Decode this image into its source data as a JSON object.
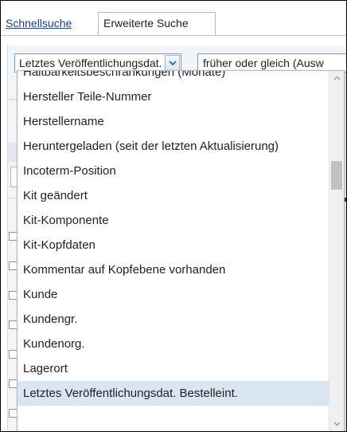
{
  "tabs": {
    "quick_search": "Schnellsuche",
    "extended_search": "Erweiterte Suche"
  },
  "filter": {
    "field_value": "Letztes Veröffentlichungsdat. Bestelleint.",
    "operator_value": "früher oder gleich (Ausw"
  },
  "dropdown": {
    "options": [
      "Haltbarkeitsbeschränkungen (Monate)",
      "Hersteller Teile-Nummer",
      "Herstellername",
      "Heruntergeladen (seit der letzten Aktualisierung)",
      "Incoterm-Position",
      "Kit geändert",
      "Kit-Komponente",
      "Kit-Kopfdaten",
      "Kommentar auf Kopfebene vorhanden",
      "Kunde",
      "Kundengr.",
      "Kundenorg.",
      "Lagerort",
      "Letztes Veröffentlichungsdat. Bestelleint."
    ],
    "selected_index": 13,
    "scroll_position": 0.25
  },
  "colors": {
    "link": "#1a3f8a",
    "selected_row": "#d9e5f1",
    "scroll_thumb": "#c1c1c1",
    "dropdown_arrow": "#2f6fc4"
  }
}
